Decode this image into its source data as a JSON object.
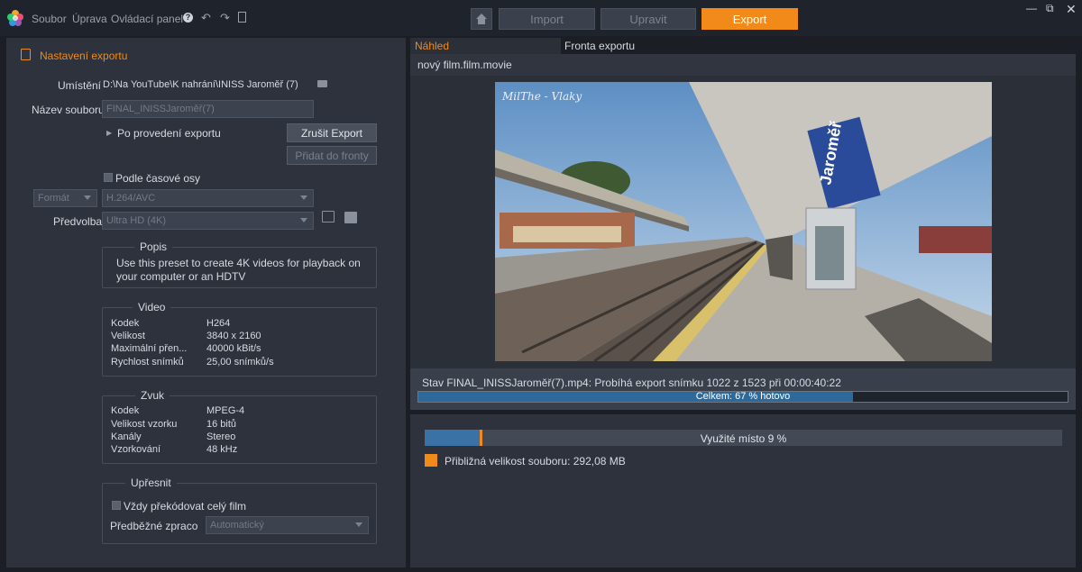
{
  "menu": {
    "file": "Soubor",
    "edit": "Úprava",
    "control_panel": "Ovládací panel",
    "help": "?"
  },
  "modes": {
    "import": "Import",
    "edit": "Upravit",
    "export": "Export"
  },
  "export_settings": {
    "title": "Nastavení exportu",
    "location_label": "Umístění",
    "location_value": "D:\\Na YouTube\\K nahrání\\INISS Jaroměř (7)",
    "filename_label": "Název souboru",
    "filename_value": "FINAL_INISSJaroměř(7)",
    "after_export": "Po provedení exportu",
    "cancel_export": "Zrušit Export",
    "add_to_queue": "Přidat do fronty",
    "by_timeline": "Podle časové osy",
    "format_select": "Formát",
    "codec_select": "H.264/AVC",
    "preset_label": "Předvolba",
    "preset_value": "Ultra HD (4K)"
  },
  "description": {
    "title": "Popis",
    "text": "Use this preset to create 4K videos for playback on your computer or an HDTV"
  },
  "video": {
    "title": "Video",
    "rows": [
      {
        "key": "Kodek",
        "value": "H264"
      },
      {
        "key": "Velikost",
        "value": "3840 x 2160"
      },
      {
        "key": "Maximální přen...",
        "value": "40000 kBit/s"
      },
      {
        "key": "Rychlost snímků",
        "value": "25,00 snímků/s"
      }
    ]
  },
  "audio": {
    "title": "Zvuk",
    "rows": [
      {
        "key": "Kodek",
        "value": "MPEG-4"
      },
      {
        "key": "Velikost vzorku",
        "value": "16 bitů"
      },
      {
        "key": "Kanály",
        "value": "Stereo"
      },
      {
        "key": "Vzorkování",
        "value": "48 kHz"
      }
    ]
  },
  "refine": {
    "title": "Upřesnit",
    "always_transcode": "Vždy překódovat celý film",
    "prerender_label": "Předběžné zpraco",
    "prerender_value": "Automatický"
  },
  "tabs": {
    "preview": "Náhled",
    "queue": "Fronta exportu"
  },
  "preview": {
    "filename": "nový film.film.movie",
    "watermark": "MilThe - Vlaky",
    "station_sign": "Jaroměř"
  },
  "status": {
    "text": "Stav FINAL_INISSJaroměř(7).mp4: Probíhá export snímku 1022 z 1523 při 00:00:40:22",
    "progress_label": "Celkem: 67 % hotovo",
    "progress": 0.67
  },
  "disk": {
    "label": "Využité místo 9 %",
    "used": 0.09,
    "legend": "Přibližná velikost souboru: 292,08 MB"
  },
  "colors": {
    "accent": "#f28a1a",
    "progress_fill": "#2d6a9c"
  }
}
